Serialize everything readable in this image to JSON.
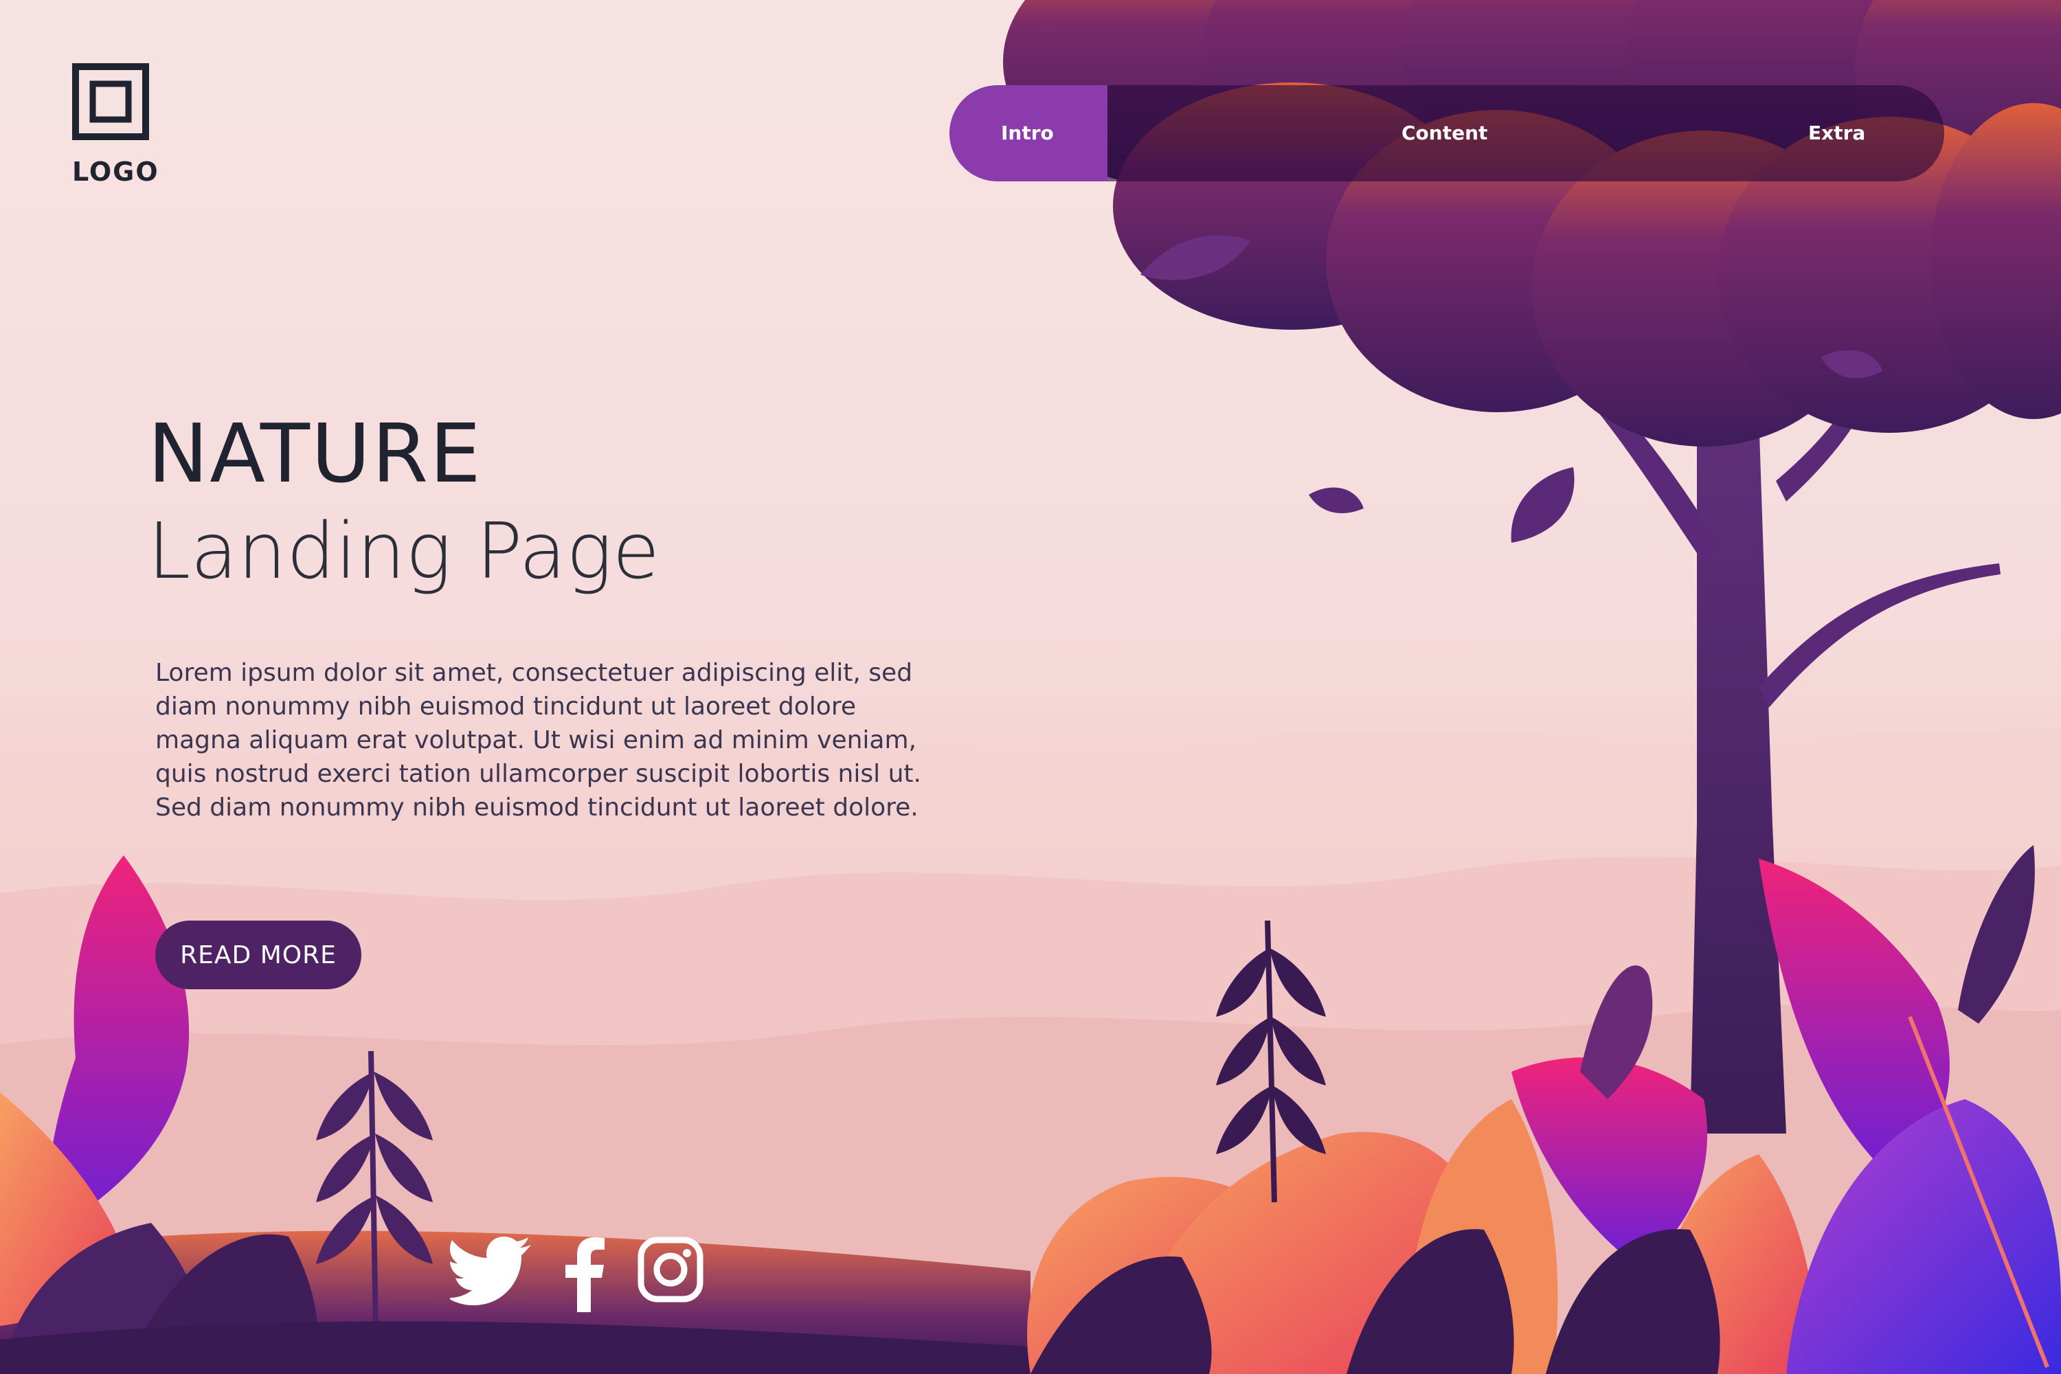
{
  "brand": {
    "logo_text": "LOGO"
  },
  "nav": {
    "items": [
      {
        "label": "Intro",
        "active": true
      },
      {
        "label": "Content",
        "active": false
      },
      {
        "label": "Extra",
        "active": false
      }
    ]
  },
  "hero": {
    "title": "NATURE",
    "subtitle": "Landing Page",
    "body": [
      "Lorem ipsum dolor sit amet, consectetuer adipiscing elit, sed",
      "diam nonummy nibh euismod tincidunt ut laoreet dolore",
      "magna aliquam erat volutpat. Ut wisi enim ad minim veniam,",
      "quis nostrud exerci tation ullamcorper suscipit lobortis nisl ut.",
      "Sed diam nonummy nibh euismod tincidunt ut laoreet dolore."
    ],
    "cta_label": "READ MORE"
  },
  "social": [
    {
      "name": "twitter-icon"
    },
    {
      "name": "facebook-icon"
    },
    {
      "name": "instagram-icon"
    }
  ],
  "colors": {
    "background": "#f6dcdc",
    "text_dark": "#1f2430",
    "accent_purple": "#8b3bab",
    "button": "#4f2266",
    "foliage_pink": "#e8217a",
    "foliage_orange": "#f28a5a",
    "tree_trunk": "#4a2466"
  }
}
